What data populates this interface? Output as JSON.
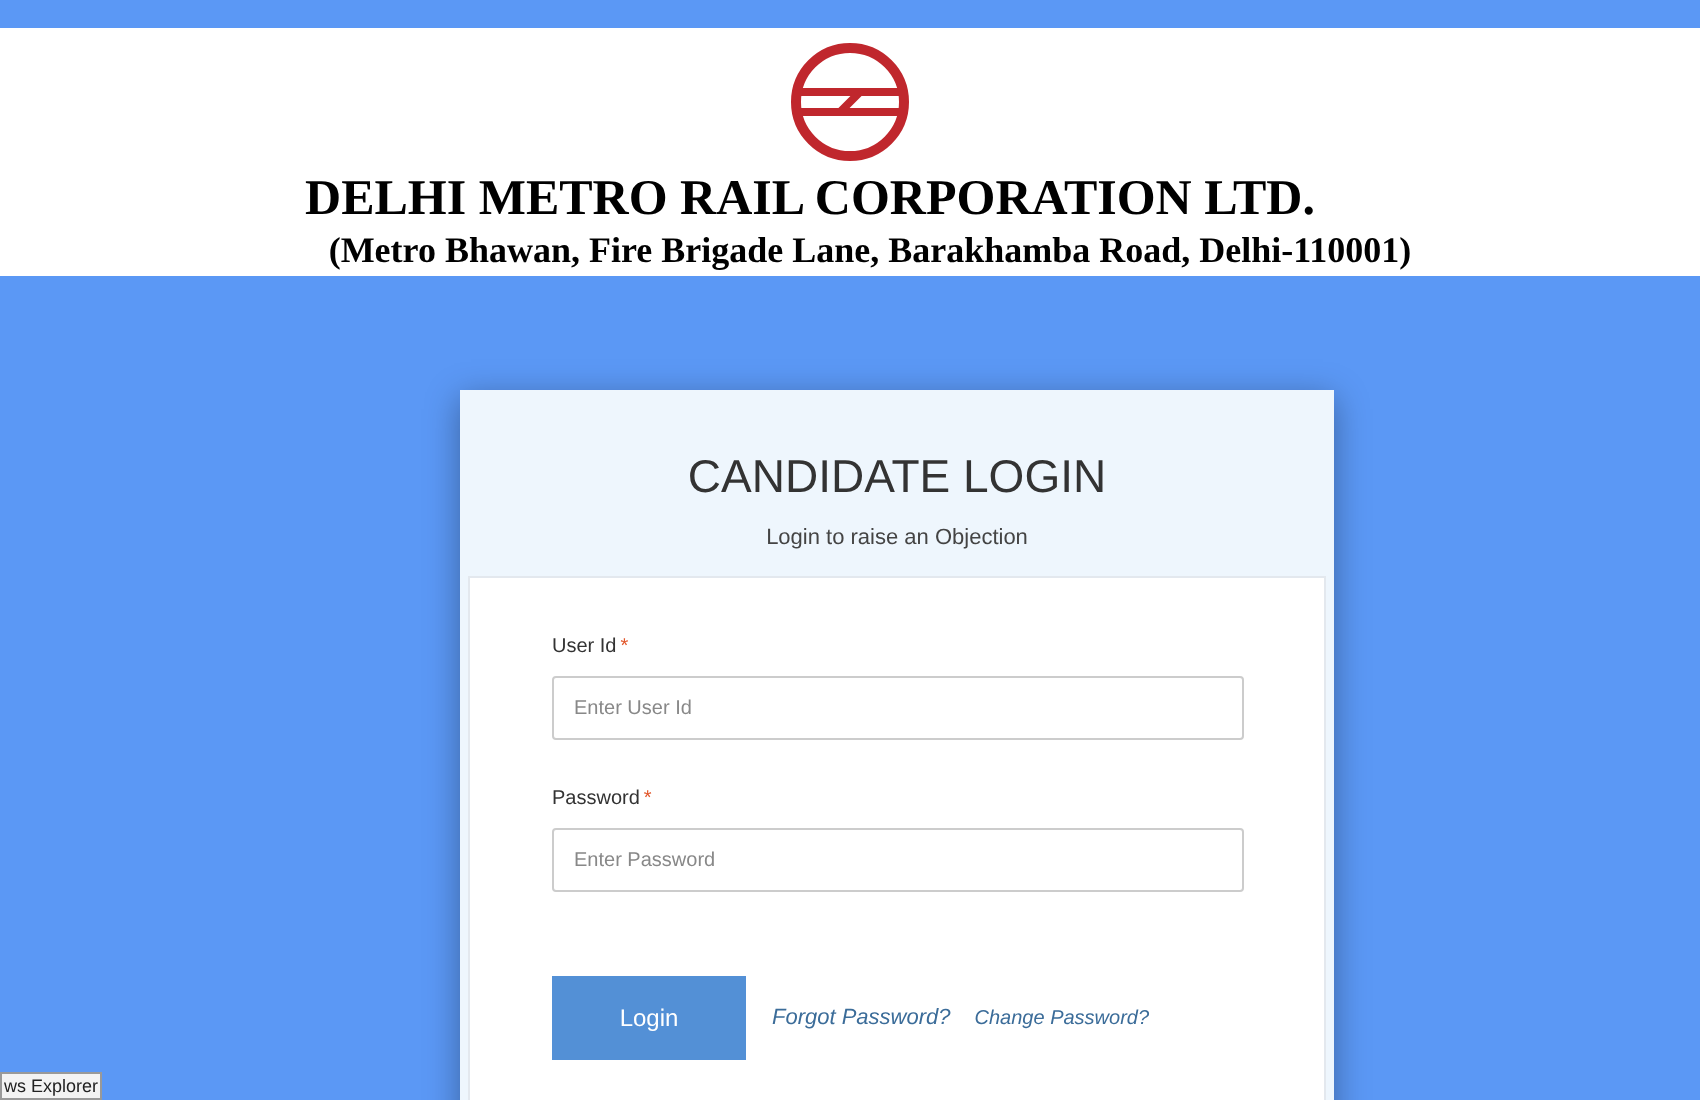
{
  "header": {
    "title": "DELHI METRO RAIL CORPORATION LTD.",
    "address": "(Metro Bhawan, Fire Brigade Lane, Barakhamba Road, Delhi-110001)"
  },
  "login": {
    "title": "CANDIDATE LOGIN",
    "subtitle": "Login to raise an Objection",
    "fields": [
      {
        "label": "User Id",
        "required_mark": "*",
        "placeholder": "Enter User Id"
      },
      {
        "label": "Password",
        "required_mark": "*",
        "placeholder": "Enter Password"
      }
    ],
    "button": "Login",
    "links": [
      "Forgot Password?",
      "Change Password?"
    ]
  },
  "status_tooltip": "ws Explorer"
}
